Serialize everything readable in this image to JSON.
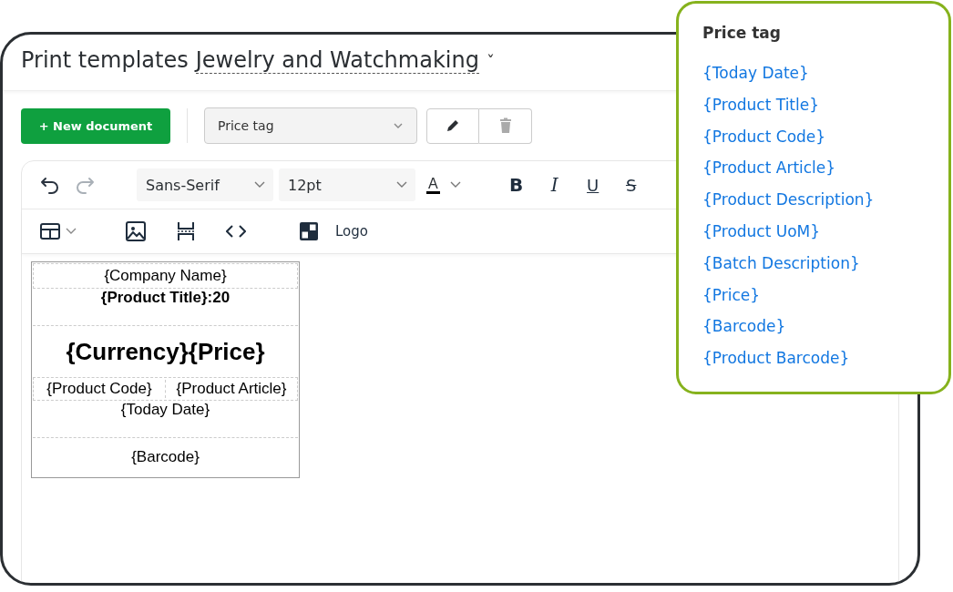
{
  "header": {
    "title": "Print templates",
    "workspace": "Jewelry and Watchmaking",
    "workspace_caret": "ˇ"
  },
  "actions": {
    "new_button": "+ New document",
    "template_select": "Price tag"
  },
  "toolbar": {
    "font": "Sans-Serif",
    "size": "12pt",
    "color_letter": "A",
    "format": [
      {
        "kind": "bold",
        "label": "B"
      },
      {
        "kind": "italic",
        "label": "I"
      },
      {
        "kind": "underline",
        "label": "U"
      },
      {
        "kind": "strike",
        "label": "S"
      }
    ],
    "logo_label": "Logo"
  },
  "template": {
    "rows": [
      {
        "kind": "boxed",
        "cells": [
          "{Company Name}"
        ]
      },
      {
        "kind": "bold",
        "cells": [
          "{Product Title}:20"
        ]
      },
      {
        "kind": "large",
        "cells": [
          "{Currency}{Price}"
        ]
      },
      {
        "kind": "split",
        "cells": [
          "{Product Code}",
          "{Product Article}"
        ]
      },
      {
        "kind": "plain",
        "cells": [
          "{Today Date}"
        ]
      },
      {
        "kind": "footer",
        "cells": [
          "{Barcode}"
        ]
      }
    ]
  },
  "popup": {
    "title": "Price tag",
    "fields": [
      "{Today Date}",
      "{Product Title}",
      "{Product Code}",
      "{Product Article}",
      "{Product Description}",
      "{Product UoM}",
      "{Batch Description}",
      "{Price}",
      "{Barcode}",
      "{Product Barcode}"
    ]
  }
}
